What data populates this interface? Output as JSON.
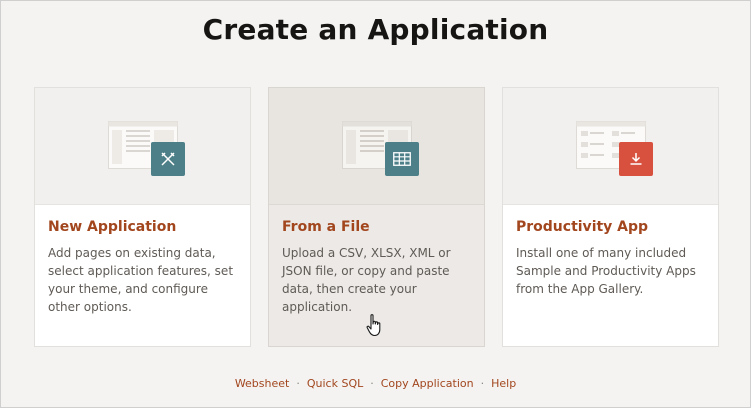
{
  "page": {
    "title": "Create an Application"
  },
  "cards": [
    {
      "title": "New Application",
      "description": "Add pages on existing data, select application features, set your theme, and configure other options.",
      "icon": "pencil-ruler-icon",
      "badge_color": "#4c7f88"
    },
    {
      "title": "From a File",
      "description": "Upload a CSV, XLSX, XML or JSON file, or copy and paste data, then create your application.",
      "icon": "table-grid-icon",
      "badge_color": "#4c7f88"
    },
    {
      "title": "Productivity App",
      "description": "Install one of many included Sample and Productivity Apps from the App Gallery.",
      "icon": "download-icon",
      "badge_color": "#d8513f"
    }
  ],
  "footer": {
    "links": [
      "Websheet",
      "Quick SQL",
      "Copy Application",
      "Help"
    ],
    "separator": "·"
  },
  "colors": {
    "link": "#a2461e",
    "background": "#f4f3f1"
  }
}
